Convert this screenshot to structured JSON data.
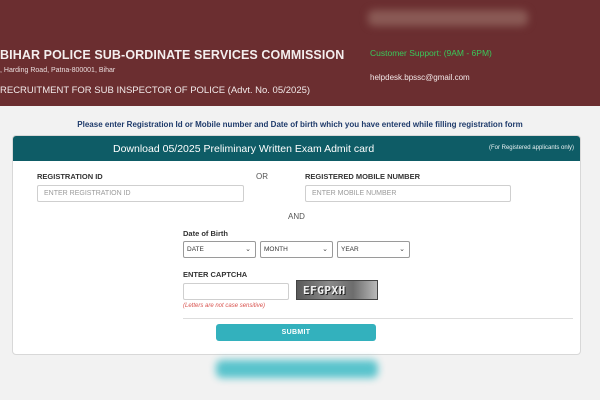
{
  "header": {
    "org_name": "BIHAR POLICE SUB-ORDINATE SERVICES COMMISSION",
    "address": ", Harding Road, Patna-800001, Bihar",
    "recruitment": "RECRUITMENT FOR SUB INSPECTOR OF POLICE (Advt. No. 05/2025)",
    "support": "Customer Support: (9AM - 6PM)",
    "helpdesk_email": "helpdesk.bpssc@gmail.com"
  },
  "instruction": "Please enter Registration Id or Mobile number and Date of birth which you have entered while filling registration form",
  "card": {
    "title": "Download 05/2025 Preliminary Written Exam Admit card",
    "note": "(For Registered applicants only)"
  },
  "form": {
    "registration_id_label": "REGISTRATION ID",
    "registration_id_placeholder": "ENTER REGISTRATION ID",
    "registration_id_value": "",
    "or_text": "OR",
    "mobile_label": "REGISTERED MOBILE NUMBER",
    "mobile_placeholder": "ENTER MOBILE NUMBER",
    "mobile_value": "",
    "and_text": "AND",
    "dob_label": "Date of Birth",
    "dob_date": "DATE",
    "dob_month": "MONTH",
    "dob_year": "YEAR",
    "captcha_label": "ENTER CAPTCHA",
    "captcha_value": "",
    "captcha_code": "EFGPXH",
    "captcha_hint": "(Letters are not case sensitive)",
    "submit_label": "SUBMIT"
  },
  "colors": {
    "header_bg": "#6b2e30",
    "card_header_bg": "#0e5c66",
    "submit_bg": "#33b1bd",
    "support_text": "#39c85a",
    "hint_text": "#d9534f"
  },
  "icons": {
    "select_arrow": "chevron-down-icon"
  }
}
